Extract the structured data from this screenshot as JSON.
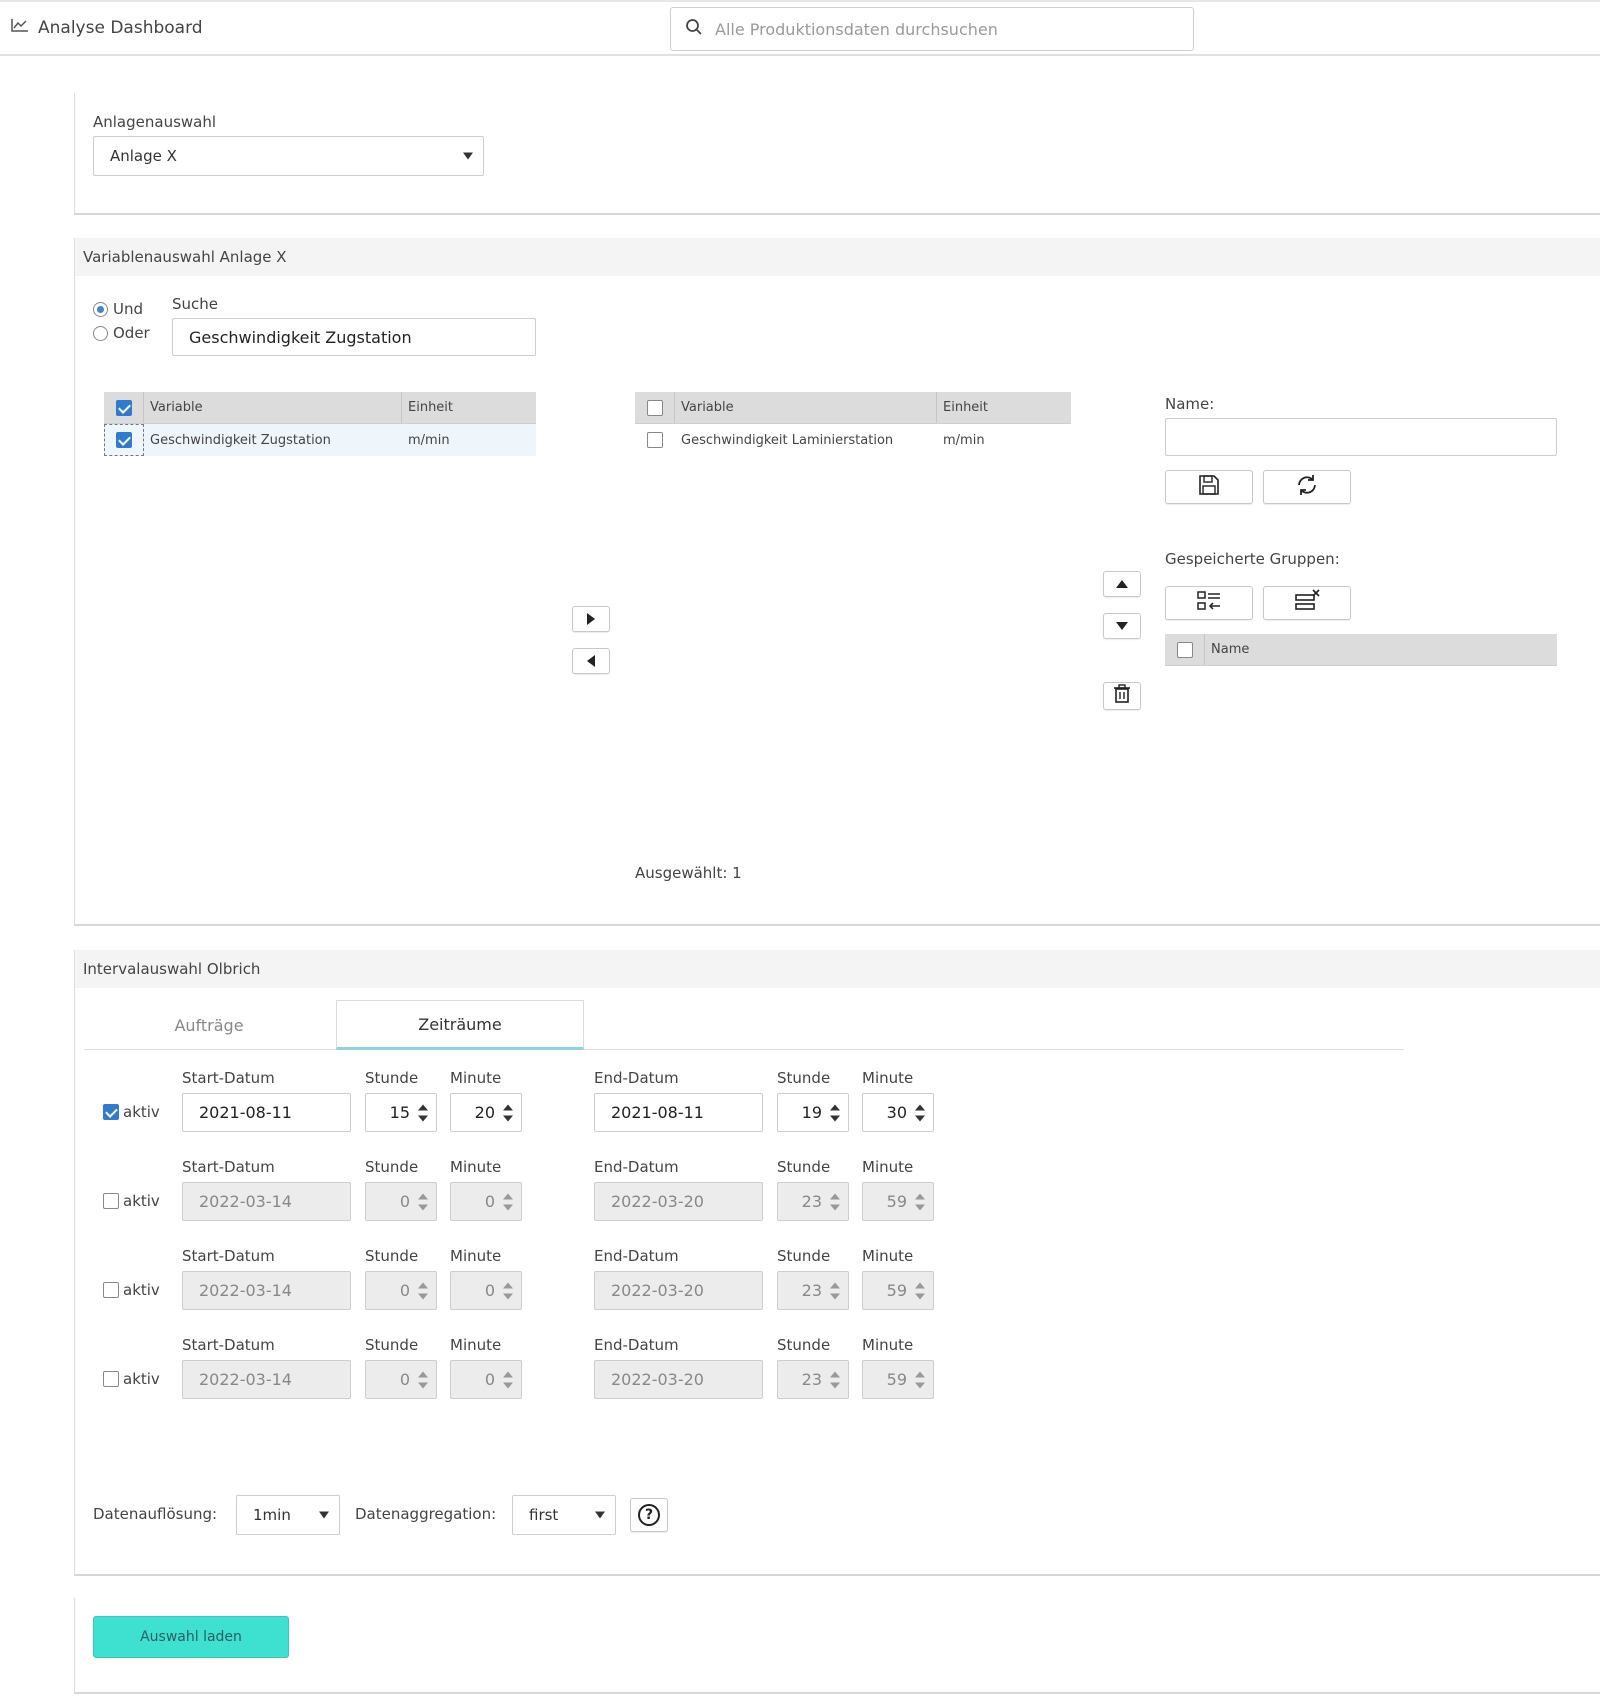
{
  "app": {
    "title": "Analyse Dashboard",
    "search_placeholder": "Alle Produktionsdaten durchsuchen"
  },
  "plant": {
    "label": "Anlagenauswahl",
    "selected": "Anlage X"
  },
  "variables": {
    "header": "Variablenauswahl Anlage X",
    "radio_and": "Und",
    "radio_or": "Oder",
    "search_label": "Suche",
    "search_value": "Geschwindigkeit Zugstation",
    "col_variable": "Variable",
    "col_unit": "Einheit",
    "left_rows": [
      {
        "variable": "Geschwindigkeit Zugstation",
        "unit": "m/min",
        "checked": true
      }
    ],
    "right_rows": [
      {
        "variable": "Geschwindigkeit Laminierstation",
        "unit": "m/min",
        "checked": false
      }
    ],
    "selected_count": "Ausgewählt: 1",
    "name_label": "Name:",
    "saved_groups_label": "Gespeicherte Gruppen:",
    "groups_col_name": "Name"
  },
  "interval": {
    "header": "Intervalauswahl Olbrich",
    "tabs": [
      "Aufträge",
      "Zeiträume"
    ],
    "active_tab": "Zeiträume",
    "labels": {
      "start": "Start-Datum",
      "hour": "Stunde",
      "minute": "Minute",
      "end": "End-Datum",
      "aktiv": "aktiv"
    },
    "rows": [
      {
        "active": true,
        "start_date": "2021-08-11",
        "start_hour": "15",
        "start_min": "20",
        "end_date": "2021-08-11",
        "end_hour": "19",
        "end_min": "30"
      },
      {
        "active": false,
        "start_date": "2022-03-14",
        "start_hour": "0",
        "start_min": "0",
        "end_date": "2022-03-20",
        "end_hour": "23",
        "end_min": "59"
      },
      {
        "active": false,
        "start_date": "2022-03-14",
        "start_hour": "0",
        "start_min": "0",
        "end_date": "2022-03-20",
        "end_hour": "23",
        "end_min": "59"
      },
      {
        "active": false,
        "start_date": "2022-03-14",
        "start_hour": "0",
        "start_min": "0",
        "end_date": "2022-03-20",
        "end_hour": "23",
        "end_min": "59"
      }
    ],
    "resolution_label": "Datenauflösung:",
    "resolution_value": "1min",
    "aggregation_label": "Datenaggregation:",
    "aggregation_value": "first",
    "help_symbol": "?"
  },
  "load_button": "Auswahl laden",
  "colors": {
    "accent": "#3ee0d0",
    "checkbox": "#2f7bd1",
    "tab_underline": "#8fd0ea"
  }
}
